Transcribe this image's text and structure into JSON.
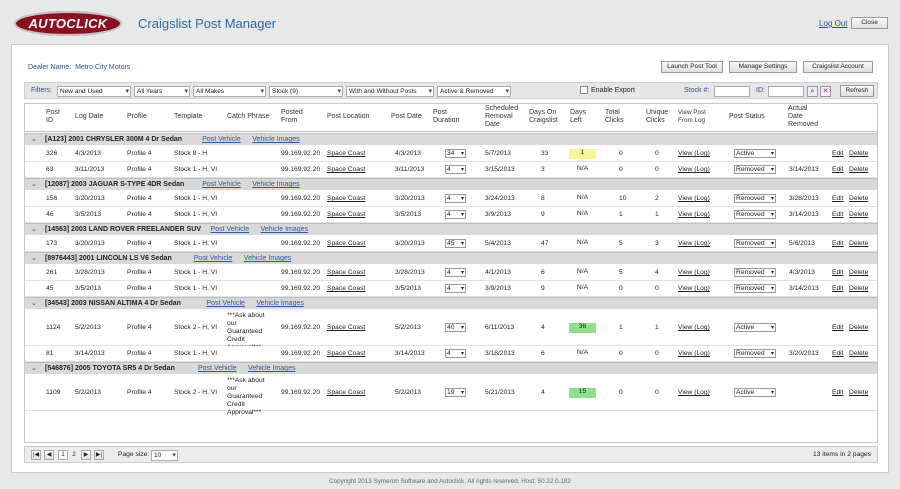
{
  "header": {
    "logo": "AUTOCLICK",
    "title": "Craigslist Post Manager",
    "logout": "Log Out",
    "close": "Close"
  },
  "dealer": {
    "label": "Dealer Name:",
    "name": "Metro City Motors"
  },
  "toolbar": {
    "launch": "Launch Post Tool",
    "settings": "Manage Settings",
    "account": "Craigslist Account"
  },
  "filters": {
    "label": "Filters:",
    "condition": "New and Used",
    "year": "All Years",
    "make": "All Makes",
    "stock": "Stock (9)",
    "posts": "With and Without Posts",
    "status": "Active & Removed",
    "export": "Enable Export",
    "stock_label": "Stock #:",
    "id_label": "ID:",
    "refresh": "Refresh"
  },
  "columns": {
    "post_id": "Post ID",
    "log_date": "Log Date",
    "profile": "Profile",
    "template": "Template",
    "catch": "Catch Phrase",
    "posted_from": "Posted From",
    "location": "Post Location",
    "post_date": "Post Date",
    "duration": "Post Duration",
    "sched": "Scheduled Removal Date",
    "days_on": "Days On Craigslist",
    "days_left": "Days Left",
    "total": "Total Clicks",
    "unique": "Unique Clicks",
    "view": "View Post From Log",
    "status": "Post Status",
    "actual": "Actual Date Removed"
  },
  "links": {
    "post_vehicle": "Post Vehicle",
    "vehicle_images": "Vehicle Images",
    "view": "View (Log)",
    "edit": "Edit",
    "delete": "Delete"
  },
  "groups": [
    {
      "title": "[A123] 2001 CHRYSLER 300M 4 Dr Sedan",
      "rows": [
        {
          "id": "326",
          "log": "4/3/2013",
          "profile": "Profile 4",
          "template": "Stock 8 - H",
          "catch": "",
          "ip": "99.169.92.20",
          "loc": "Space Coast",
          "date": "4/3/2013",
          "dur": "34",
          "sched": "5/7/2013",
          "on": "33",
          "left": "1",
          "left_color": "#fbf59a",
          "total": "0",
          "unique": "0",
          "status": "Active",
          "removed": ""
        },
        {
          "id": "63",
          "log": "3/11/2013",
          "profile": "Profile 4",
          "template": "Stock 1 - H, VI",
          "catch": "",
          "ip": "99.169.92.20",
          "loc": "Space Coast",
          "date": "3/11/2013",
          "dur": "4",
          "sched": "3/15/2013",
          "on": "3",
          "left": "N/A",
          "left_color": "",
          "total": "0",
          "unique": "0",
          "status": "Removed",
          "removed": "3/14/2013"
        }
      ]
    },
    {
      "title": "[12087] 2003 JAGUAR S-TYPE 4DR Sedan",
      "rows": [
        {
          "id": "156",
          "log": "3/20/2013",
          "profile": "Profile 4",
          "template": "Stock 1 - H, VI",
          "catch": "",
          "ip": "99.169.92.20",
          "loc": "Space Coast",
          "date": "3/20/2013",
          "dur": "4",
          "sched": "3/24/2013",
          "on": "8",
          "left": "N/A",
          "left_color": "",
          "total": "10",
          "unique": "2",
          "status": "Removed",
          "removed": "3/28/2013"
        },
        {
          "id": "46",
          "log": "3/5/2013",
          "profile": "Profile 4",
          "template": "Stock 1 - H, VI",
          "catch": "",
          "ip": "99.169.92.20",
          "loc": "Space Coast",
          "date": "3/5/2013",
          "dur": "4",
          "sched": "3/9/2013",
          "on": "9",
          "left": "N/A",
          "left_color": "",
          "total": "1",
          "unique": "1",
          "status": "Removed",
          "removed": "3/14/2013"
        }
      ]
    },
    {
      "title": "[14563] 2003 LAND ROVER FREELANDER SUV",
      "rows": [
        {
          "id": "173",
          "log": "3/20/2013",
          "profile": "Profile 4",
          "template": "Stock 1 - H, VI",
          "catch": "",
          "ip": "99.169.92.20",
          "loc": "Space Coast",
          "date": "3/20/2013",
          "dur": "45",
          "sched": "5/4/2013",
          "on": "47",
          "left": "N/A",
          "left_color": "",
          "total": "5",
          "unique": "3",
          "status": "Removed",
          "removed": "5/6/2013"
        }
      ]
    },
    {
      "title": "[8976443] 2001 LINCOLN LS V6 Sedan",
      "rows": [
        {
          "id": "261",
          "log": "3/28/2013",
          "profile": "Profile 4",
          "template": "Stock 1 - H, VI",
          "catch": "",
          "ip": "99.169.92.20",
          "loc": "Space Coast",
          "date": "3/28/2013",
          "dur": "4",
          "sched": "4/1/2013",
          "on": "6",
          "left": "N/A",
          "left_color": "",
          "total": "5",
          "unique": "4",
          "status": "Removed",
          "removed": "4/3/2013"
        },
        {
          "id": "45",
          "log": "3/5/2013",
          "profile": "Profile 4",
          "template": "Stock 1 - H, VI",
          "catch": "",
          "ip": "99.169.92.20",
          "loc": "Space Coast",
          "date": "3/5/2013",
          "dur": "4",
          "sched": "3/9/2013",
          "on": "9",
          "left": "N/A",
          "left_color": "",
          "total": "0",
          "unique": "0",
          "status": "Removed",
          "removed": "3/14/2013"
        }
      ]
    },
    {
      "title": "[34543] 2003 NISSAN ALTIMA 4 Dr Sedan",
      "rows": [
        {
          "id": "1124",
          "log": "5/2/2013",
          "profile": "Profile 4",
          "template": "Stock 2 - H, VI",
          "catch": "***Ask about our Guaranteed Credit Approval***",
          "ip": "99.169.92.20",
          "loc": "Space Coast",
          "date": "5/2/2013",
          "dur": "40",
          "sched": "6/11/2013",
          "on": "4",
          "left": "36",
          "left_color": "#8fe08a",
          "total": "1",
          "unique": "1",
          "status": "Active",
          "removed": ""
        },
        {
          "id": "81",
          "log": "3/14/2013",
          "profile": "Profile 4",
          "template": "Stock 1 - H, VI",
          "catch": "",
          "ip": "99.169.92.20",
          "loc": "Space Coast",
          "date": "3/14/2013",
          "dur": "4",
          "sched": "3/18/2013",
          "on": "6",
          "left": "N/A",
          "left_color": "",
          "total": "0",
          "unique": "0",
          "status": "Removed",
          "removed": "3/20/2013"
        }
      ]
    },
    {
      "title": "[546876] 2005 TOYOTA SR5 4 Dr Sedan",
      "rows": [
        {
          "id": "1109",
          "log": "5/2/2013",
          "profile": "Profile 4",
          "template": "Stock 2 - H, VI",
          "catch": "***Ask about our Guaranteed Credit Approval***",
          "ip": "99.169.92.20",
          "loc": "Space Coast",
          "date": "5/2/2013",
          "dur": "19",
          "sched": "5/21/2013",
          "on": "4",
          "left": "15",
          "left_color": "#8fe08a",
          "total": "0",
          "unique": "0",
          "status": "Active",
          "removed": ""
        }
      ]
    }
  ],
  "pager": {
    "pages": [
      "1",
      "2"
    ],
    "size_label": "Page size:",
    "size": "10",
    "summary": "13 items in 2 pages"
  },
  "footer": "Copyright 2013 Symeron Software and Autoclick. All rights reserved. Host: 50.22.0.182"
}
